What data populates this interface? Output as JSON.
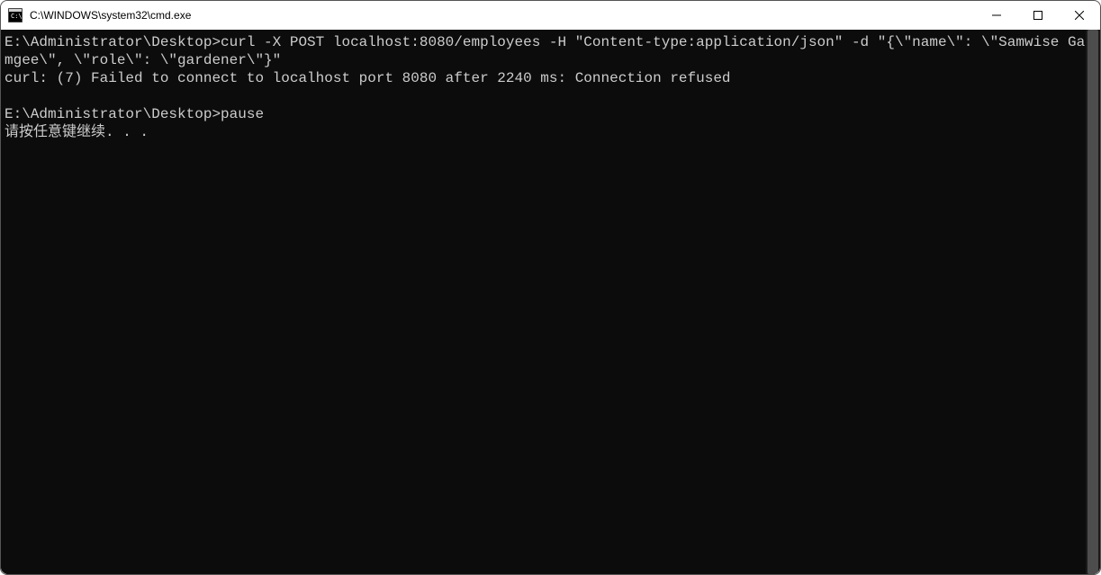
{
  "window": {
    "title": "C:\\WINDOWS\\system32\\cmd.exe"
  },
  "terminal": {
    "line1": "E:\\Administrator\\Desktop>curl -X POST localhost:8080/employees -H \"Content-type:application/json\" -d \"{\\\"name\\\": \\\"Samwise Gamgee\\\", \\\"role\\\": \\\"gardener\\\"}\"",
    "line2": "curl: (7) Failed to connect to localhost port 8080 after 2240 ms: Connection refused",
    "line3": "",
    "line4": "E:\\Administrator\\Desktop>pause",
    "line5": "请按任意键继续. . ."
  }
}
